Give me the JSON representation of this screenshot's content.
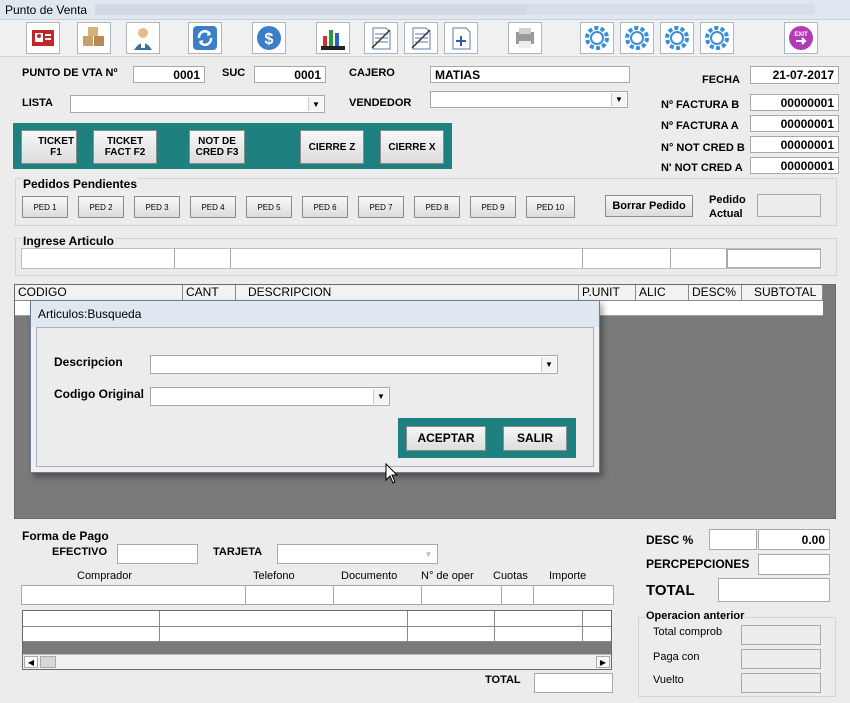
{
  "window": {
    "title": "Punto de Venta"
  },
  "header": {
    "punto_label": "PUNTO DE VTA Nº",
    "punto_value": "0001",
    "suc_label": "SUC",
    "suc_value": "0001",
    "cajero_label": "CAJERO",
    "cajero_value": "MATIAS",
    "lista_label": "LISTA",
    "lista_value": "",
    "vendedor_label": "VENDEDOR",
    "vendedor_value": "",
    "fecha_label": "FECHA",
    "fecha_value": "21-07-2017",
    "factura_b_label": "Nº FACTURA B",
    "factura_b_value": "00000001",
    "factura_a_label": "Nº FACTURA A",
    "factura_a_value": "00000001",
    "notcred_b_label": "N° NOT CRED B",
    "notcred_b_value": "00000001",
    "notcred_a_label": "N' NOT CRED A",
    "notcred_a_value": "00000001"
  },
  "toolbar": {
    "icons": [
      "id-card-icon",
      "boxes-icon",
      "user-icon",
      "refresh-icon",
      "dollar-icon",
      "chart-icon",
      "document-icon",
      "document-icon",
      "document-add-icon",
      "printer-icon",
      "gear-icon",
      "gear-icon",
      "gear-icon",
      "gear-icon",
      "exit-icon"
    ],
    "exit_label": "EXIT"
  },
  "actions": {
    "ticket_f1": "TICKET\nF1",
    "ticket_fact_f2": "TICKET\nFACT   F2",
    "not_cred_f3": "NOT DE\nCRED F3",
    "cierre_z": "CIERRE Z",
    "cierre_x": "CIERRE X"
  },
  "pedidos": {
    "label": "Pedidos Pendientes",
    "buttons": [
      "PED 1",
      "PED 2",
      "PED 3",
      "PED 4",
      "PED 5",
      "PED 6",
      "PED 7",
      "PED 8",
      "PED 9",
      "PED 10"
    ],
    "borrar_label": "Borrar Pedido",
    "actual_label": "Pedido\nActual",
    "actual_value": ""
  },
  "ingrese": {
    "label": "Ingrese Articulo"
  },
  "items_table": {
    "columns": [
      "CODIGO",
      "CANT",
      "DESCRIPCION",
      "P.UNIT",
      "ALIC",
      "DESC%",
      "SUBTOTAL"
    ]
  },
  "dialog": {
    "title": "Articulos:Busqueda",
    "descripcion_label": "Descripcion",
    "descripcion_value": "",
    "codigo_label": "Codigo Original",
    "codigo_value": "",
    "aceptar_label": "ACEPTAR",
    "salir_label": "SALIR"
  },
  "pago": {
    "label": "Forma de Pago",
    "efectivo_label": "EFECTIVO",
    "efectivo_value": "",
    "tarjeta_label": "TARJETA",
    "tarjeta_value": "",
    "columns": [
      "Comprador",
      "Telefono",
      "Documento",
      "N° de oper",
      "Cuotas",
      "Importe"
    ],
    "total_label": "TOTAL",
    "total_value": ""
  },
  "totals": {
    "desc_label": "DESC %",
    "desc_value": "0.00",
    "percepciones_label": "PERCPEPCIONES",
    "percepciones_value": "",
    "total_label": "TOTAL",
    "total_value": ""
  },
  "operacion": {
    "label": "Operacion anterior",
    "total_comprob_label": "Total comprob",
    "paga_con_label": "Paga con",
    "vuelto_label": "Vuelto"
  },
  "colors": {
    "teal": "#1f8080",
    "grid_bg": "#7a7a7a",
    "title_bg": "#dfe7f1"
  }
}
